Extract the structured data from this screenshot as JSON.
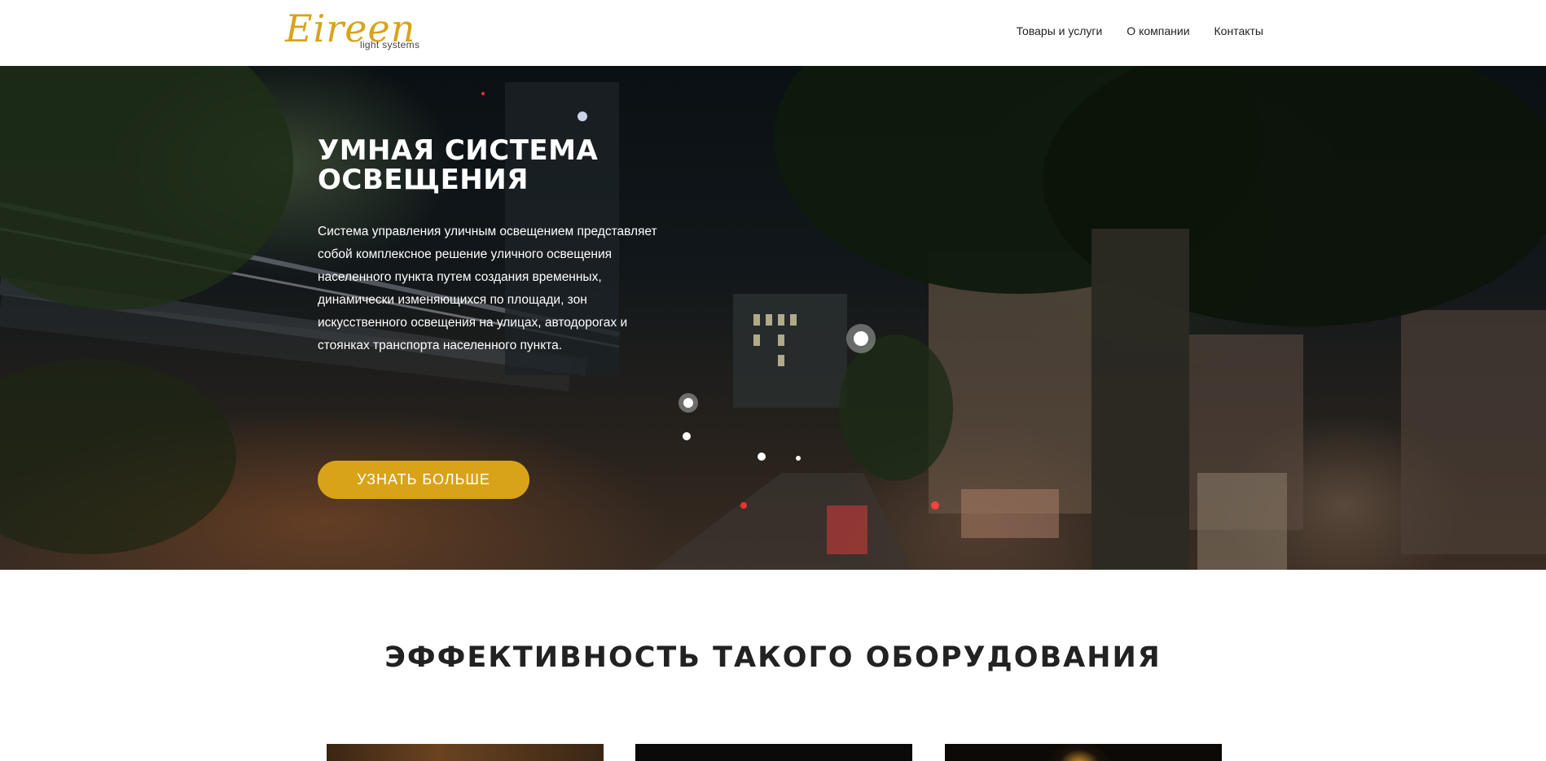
{
  "header": {
    "logo": {
      "word": "Eireen",
      "sub": "light systems"
    },
    "nav": [
      {
        "label": "Товары и услуги"
      },
      {
        "label": "О компании"
      },
      {
        "label": "Контакты"
      }
    ]
  },
  "hero": {
    "title": "УМНАЯ СИСТЕМА\nОСВЕЩЕНИЯ",
    "text": "Система управления уличным освещением представляет собой комплексное решение  уличного освещения населенного пункта путем создания временных, динамически изменяющихся по площади, зон искусственного освещения на улицах, автодорогах и стоянках транспорта населенного пункта.",
    "button_label": "УЗНАТЬ БОЛЬШЕ"
  },
  "section": {
    "title": "ЭФФЕКТИВНОСТЬ ТАКОГО ОБОРУДОВАНИЯ"
  },
  "colors": {
    "accent": "#d9a319",
    "dark_text": "#222222"
  }
}
